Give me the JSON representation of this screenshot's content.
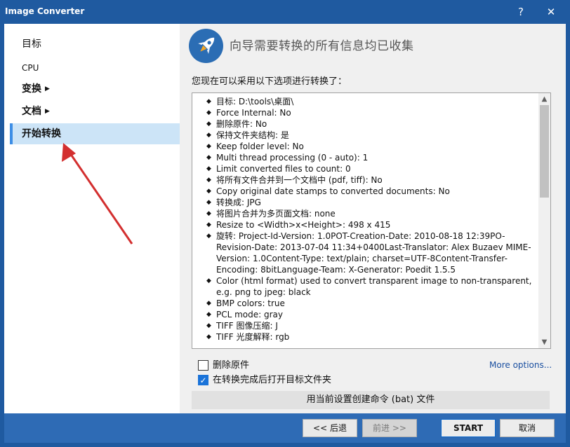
{
  "window": {
    "title": "Image Converter",
    "help_label": "?",
    "close_label": "✕"
  },
  "sidebar": {
    "items": [
      {
        "label": "目标"
      },
      {
        "label": "CPU"
      },
      {
        "label": "变换"
      },
      {
        "label": "文档"
      },
      {
        "label": "开始转换"
      }
    ],
    "caret": "▶"
  },
  "header": {
    "title": "向导需要转换的所有信息均已收集",
    "icon": "rocket-icon"
  },
  "main": {
    "subtitle": "您现在可以采用以下选项进行转换了：",
    "bullet": "◆",
    "summary_items": [
      "目标: D:\\tools\\桌面\\",
      "Force Internal: No",
      "删除原件: No",
      "保持文件夹结构: 是",
      "Keep folder level: No",
      "Multi thread processing (0 - auto): 1",
      "Limit converted files to count: 0",
      "将所有文件合并到一个文档中 (pdf, tiff): No",
      "Copy original date stamps to converted documents: No",
      "转换成: JPG",
      "将图片合并为多页面文档: none",
      "Resize to <Width>x<Height>: 498 x 415",
      "旋转: Project-Id-Version: 1.0POT-Creation-Date: 2010-08-18 12:39PO-Revision-Date: 2013-07-04 11:34+0400Last-Translator: Alex Buzaev MIME-Version: 1.0Content-Type: text/plain; charset=UTF-8Content-Transfer-Encoding: 8bitLanguage-Team: X-Generator: Poedit 1.5.5",
      "Color (html format) used to convert transparent image to non-transparent, e.g. png to jpeg: black",
      "BMP colors: true",
      "PCL mode: gray",
      "TIFF 图像压缩: J",
      "TIFF 光度解释: rgb"
    ],
    "scroll_up": "▲",
    "scroll_down": "▼",
    "delete_original_label": "删除原件",
    "open_folder_label": "在转换完成后打开目标文件夹",
    "open_folder_checkmark": "✓",
    "more_options_label": "More options...",
    "create_cmd_label": "用当前设置创建命令 (bat) 文件"
  },
  "footer": {
    "back_label": "<< 后退",
    "next_label": "前进 >>",
    "start_label": "START",
    "cancel_label": "取消"
  },
  "colors": {
    "titlebar": "#1f5aa0",
    "footer": "#2e6bb5",
    "selected_nav": "#cce4f7",
    "arrow": "#d32f2f"
  }
}
